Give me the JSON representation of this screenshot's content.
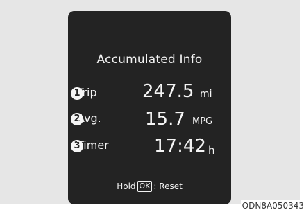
{
  "screen": {
    "title": "Accumulated Info",
    "rows": [
      {
        "badge": "1",
        "label": "Trip",
        "value": "247.5",
        "unit": "mi"
      },
      {
        "badge": "2",
        "label": "Avg.",
        "value": "15.7",
        "unit": "MPG"
      },
      {
        "badge": "3",
        "label": "Timer",
        "value": "17:42",
        "unit": "h"
      }
    ],
    "hint": {
      "prefix": "Hold",
      "key": "OK",
      "suffix": ": Reset"
    }
  },
  "figure_code": "ODN8A050343",
  "colors": {
    "display_bg": "#232323",
    "panel_bg": "#e6e6e6",
    "text": "#f5f5f5"
  }
}
